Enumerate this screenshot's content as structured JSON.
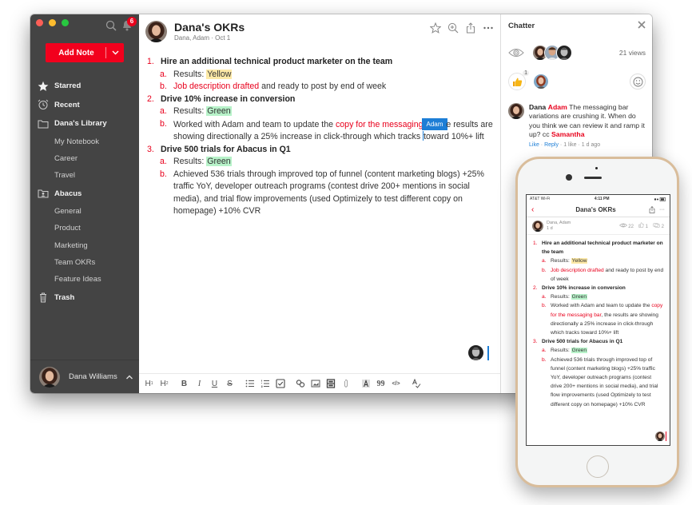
{
  "colors": {
    "accent": "#e8001c",
    "sidebar_bg": "#444444",
    "mention_blue": "#1d7ed6",
    "highlight_yellow": "#fde9a6",
    "highlight_green": "#b7f2c9"
  },
  "sidebar": {
    "notification_count": "6",
    "add_note_label": "Add Note",
    "items": [
      {
        "label": "Starred",
        "icon": "star-icon",
        "level": "top"
      },
      {
        "label": "Recent",
        "icon": "alarm-clock-icon",
        "level": "top"
      },
      {
        "label": "Dana's Library",
        "icon": "folder-icon",
        "level": "top"
      },
      {
        "label": "My Notebook",
        "level": "sub"
      },
      {
        "label": "Career",
        "level": "sub"
      },
      {
        "label": "Travel",
        "level": "sub"
      },
      {
        "label": "Abacus",
        "icon": "shared-folder-icon",
        "level": "top"
      },
      {
        "label": "General",
        "level": "sub"
      },
      {
        "label": "Product",
        "level": "sub"
      },
      {
        "label": "Marketing",
        "level": "sub"
      },
      {
        "label": "Team OKRs",
        "level": "sub"
      },
      {
        "label": "Feature Ideas",
        "level": "sub"
      },
      {
        "label": "Trash",
        "icon": "trash-icon",
        "level": "top"
      }
    ],
    "user_name": "Dana Williams"
  },
  "note": {
    "title": "Dana's OKRs",
    "meta": "Dana, Adam · Oct 1",
    "items": [
      {
        "num": "1.",
        "title": "Hire an additional technical product marketer on the team",
        "sub": [
          {
            "letter": "a.",
            "prefix": "Results: ",
            "highlight": "Yellow"
          },
          {
            "letter": "b.",
            "red": "Job description drafted",
            "rest": " and ready to post by end of week"
          }
        ]
      },
      {
        "num": "2.",
        "title": "Drive 10% increase in conversion",
        "sub": [
          {
            "letter": "a.",
            "prefix": "Results: ",
            "highlight": "Green"
          },
          {
            "letter": "b.",
            "before": "Worked with Adam and team to update the ",
            "red": "copy for the messaging",
            "mention_tag": "Adam",
            "after": "e results are showing directionally a 25% increase in click-through which tracks ",
            "after_cursor": "toward 10%+ lift"
          }
        ]
      },
      {
        "num": "3.",
        "title": "Drive 500 trials for Abacus in Q1",
        "sub": [
          {
            "letter": "a.",
            "prefix": "Results: ",
            "highlight": "Green"
          },
          {
            "letter": "b.",
            "text": "Achieved 536 trials through improved top of funnel (content marketing blogs) +25% traffic YoY,  developer outreach programs (contest drive 200+ mentions in social media), and trial flow improvements (used Optimizely to test different copy on homepage) +10% CVR"
          }
        ]
      }
    ]
  },
  "toolbar": {
    "buttons": [
      "H1",
      "H2",
      "B",
      "I",
      "U",
      "S",
      "Bulleted list",
      "Numbered list",
      "Checklist",
      "Link",
      "Image",
      "Table",
      "Attachment",
      "Highlight",
      "Quote",
      "Code",
      "Spellcheck"
    ],
    "h1": "H",
    "h2": "H",
    "bold": "B",
    "italic": "I",
    "underline": "U",
    "strike": "S",
    "quote": "99",
    "code": "</>"
  },
  "chatter": {
    "title": "Chatter",
    "views": "21 views",
    "like_count": "1",
    "comment": {
      "author": "Dana",
      "mention": "Adam",
      "text": " The messaging bar variations are crushing it. When do you think we can review it and ramp it up? cc ",
      "cc_mention": "Samantha",
      "like_action": "Like",
      "reply_action": "Reply",
      "stats": " · 1 like · 1 d ago"
    }
  },
  "phone": {
    "status_carrier": "AT&T Wi-Fi",
    "status_time": "4:11 PM",
    "title": "Dana's OKRs",
    "authors": "Dana, Adam",
    "age": "1 d",
    "views": "22",
    "likes": "1",
    "comments": "2",
    "items": [
      {
        "num": "1.",
        "title": "Hire an additional technical product marketer on the team",
        "sub": [
          {
            "letter": "a.",
            "prefix": "Results: ",
            "highlight": "Yellow"
          },
          {
            "letter": "b.",
            "red": "Job description drafted",
            "rest": " and ready to post by end of week"
          }
        ]
      },
      {
        "num": "2.",
        "title": "Drive 10% increase in conversion",
        "sub": [
          {
            "letter": "a.",
            "prefix": "Results: ",
            "highlight": "Green"
          },
          {
            "letter": "b.",
            "before": "Worked with Adam and team to update the ",
            "red": "copy for the messaging bar",
            "after": ", the results are showing directionally a 25% increase in click-through which tracks toward 10%+ lift"
          }
        ]
      },
      {
        "num": "3.",
        "title": "Drive 500 trials for Abacus in Q1",
        "sub": [
          {
            "letter": "a.",
            "prefix": "Results: ",
            "highlight": "Green"
          },
          {
            "letter": "b.",
            "text": "Achieved 536 trials through improved top of funnel (content marketing blogs) +25% traffic YoY,  developer outreach programs (contest drive 200+ mentions in social media), and trial flow improvements (used Optimizely to test different copy on homepage) +10% CVR"
          }
        ]
      }
    ]
  }
}
